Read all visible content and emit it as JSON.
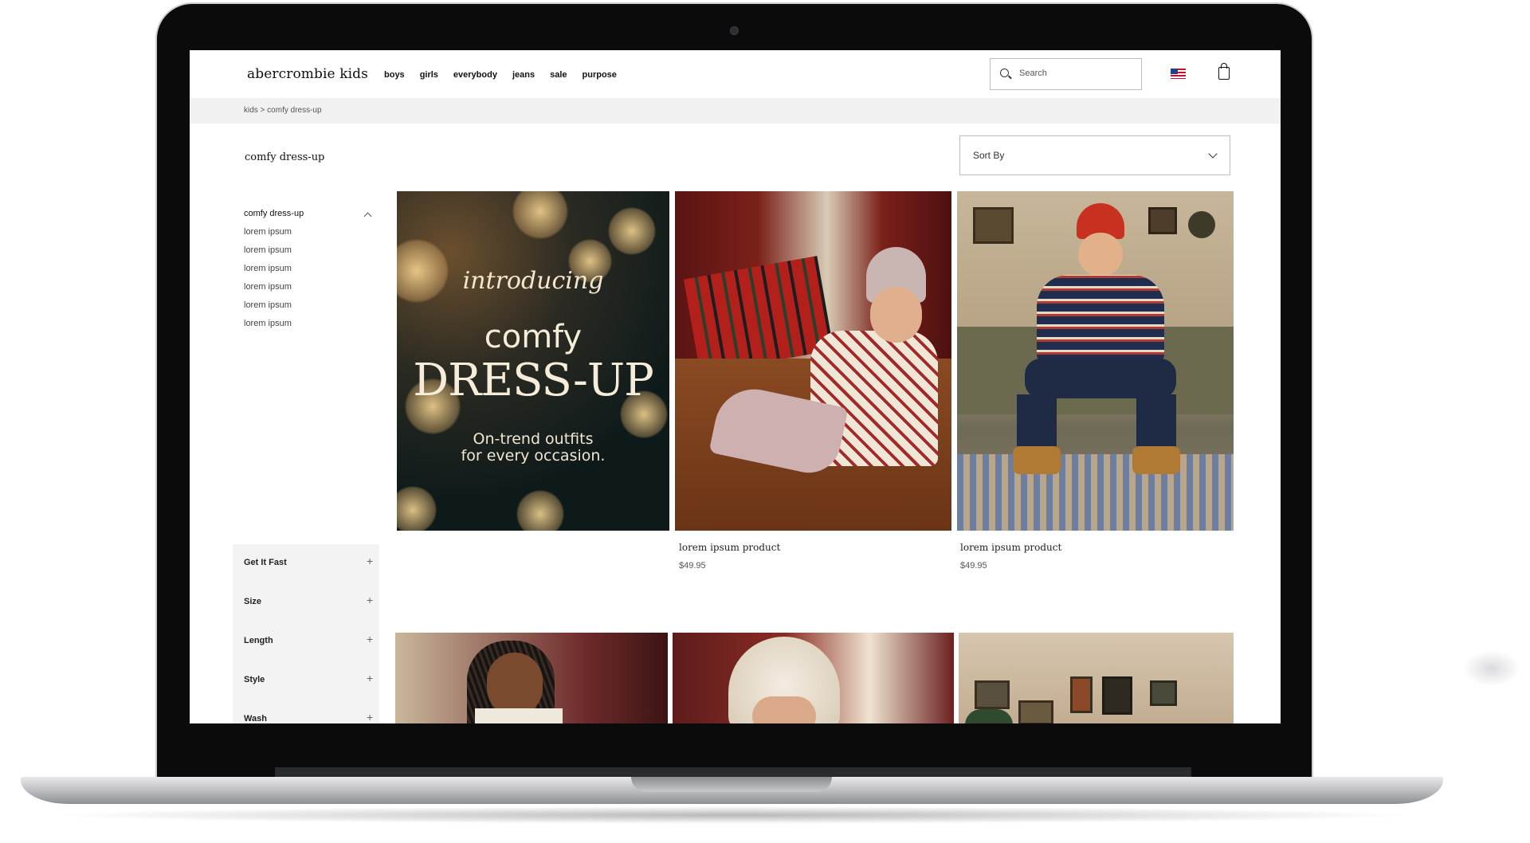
{
  "header": {
    "logo": "abercrombie kids",
    "nav": [
      "boys",
      "girls",
      "everybody",
      "jeans",
      "sale",
      "purpose"
    ],
    "search_placeholder": "Search"
  },
  "breadcrumb": "kids > comfy dress-up",
  "page_title": "comfy dress-up",
  "sort": {
    "label": "Sort By"
  },
  "categories": {
    "heading": "comfy dress-up",
    "items": [
      "lorem ipsum",
      "lorem ipsum",
      "lorem ipsum",
      "lorem ipsum",
      "lorem ipsum",
      "lorem ipsum"
    ]
  },
  "filters": [
    "Get It Fast",
    "Size",
    "Length",
    "Style",
    "Wash"
  ],
  "promo": {
    "intro": "introducing",
    "line1": "comfy",
    "line2": "DRESS-UP",
    "tagline_1": "On-trend outfits",
    "tagline_2": "for every occasion."
  },
  "products": [
    {
      "name": "lorem ipsum product",
      "price": "$49.95"
    },
    {
      "name": "lorem ipsum product",
      "price": "$49.95"
    }
  ]
}
